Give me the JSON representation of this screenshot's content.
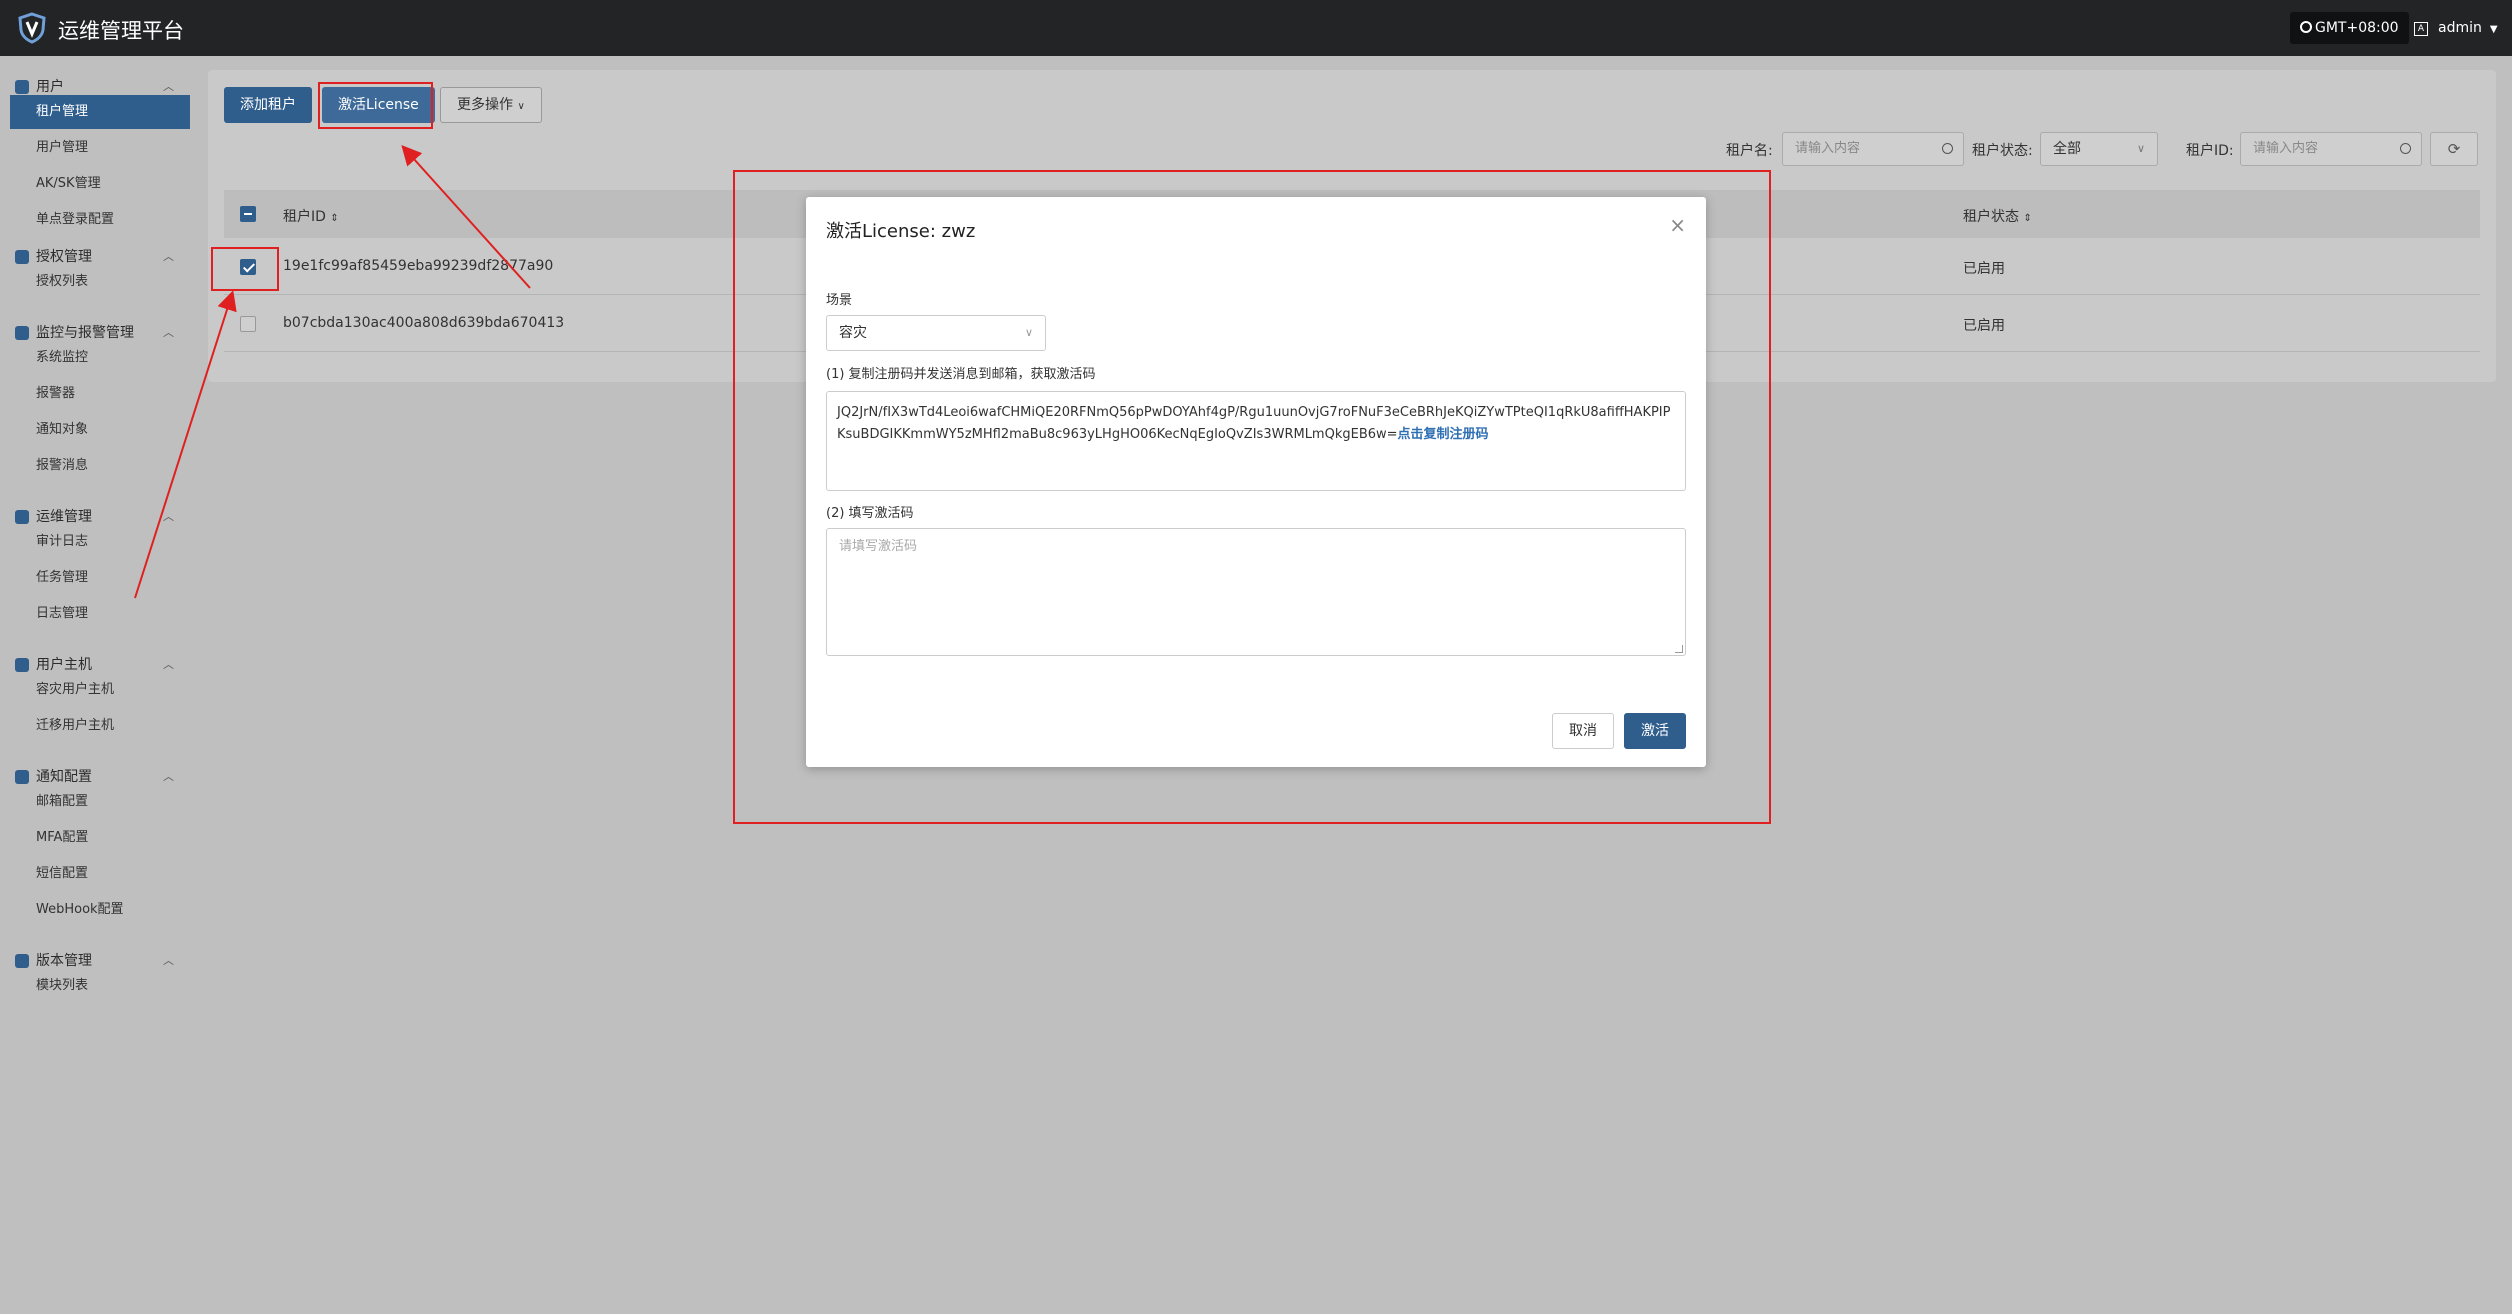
{
  "header": {
    "app_title": "运维管理平台",
    "timezone": "GMT+08:00",
    "user": "admin"
  },
  "sidebar": {
    "groups": [
      {
        "label": "用户",
        "items": [
          "租户管理",
          "用户管理",
          "AK/SK管理",
          "单点登录配置"
        ]
      },
      {
        "label": "授权管理",
        "items": [
          "授权列表"
        ]
      },
      {
        "label": "监控与报警管理",
        "items": [
          "系统监控",
          "报警器",
          "通知对象",
          "报警消息"
        ]
      },
      {
        "label": "运维管理",
        "items": [
          "审计日志",
          "任务管理",
          "日志管理"
        ]
      },
      {
        "label": "用户主机",
        "items": [
          "容灾用户主机",
          "迁移用户主机"
        ]
      },
      {
        "label": "通知配置",
        "items": [
          "邮箱配置",
          "MFA配置",
          "短信配置",
          "WebHook配置"
        ]
      },
      {
        "label": "版本管理",
        "items": [
          "模块列表"
        ]
      }
    ]
  },
  "toolbar": {
    "add": "添加租户",
    "activate": "激活License",
    "more": "更多操作"
  },
  "filters": {
    "tenant_name_label": "租户名:",
    "tenant_name_placeholder": "请输入内容",
    "status_label": "租户状态:",
    "status_value": "全部",
    "tenant_id_label": "租户ID:",
    "tenant_id_placeholder": "请输入内容"
  },
  "table": {
    "headers": [
      "租户ID",
      "租户状态"
    ],
    "rows": [
      {
        "id": "19e1fc99af85459eba99239df2877a90",
        "status": "已启用",
        "checked": true
      },
      {
        "id": "b07cbda130ac400a808d639bda670413",
        "status": "已启用",
        "checked": false
      }
    ]
  },
  "modal": {
    "title": "激活License: zwz",
    "scene_label": "场景",
    "scene_value": "容灾",
    "step1": "(1) 复制注册码并发送消息到邮箱，获取激活码",
    "code": "JQ2JrN/fIX3wTd4Leoi6wafCHMiQE20RFNmQ56pPwDOYAhf4gP/Rgu1uunOvjG7roFNuF3eCeBRhJeKQiZYwTPteQI1qRkU8afiffHAKPIPKsuBDGIKKmmWY5zMHfl2maBu8c963yLHgHO06KecNqEgIoQvZIs3WRMLmQkgEB6w=",
    "copy_link": "点击复制注册码",
    "step2": "(2) 填写激活码",
    "activation_placeholder": "请填写激活码",
    "cancel": "取消",
    "submit": "激活"
  }
}
